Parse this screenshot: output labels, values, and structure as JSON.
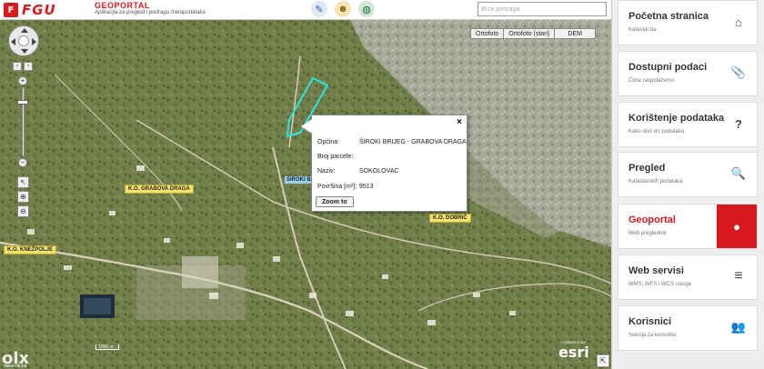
{
  "header": {
    "logo_mark": "F",
    "logo_text": "FGU",
    "brand_title": "GEOPORTAL",
    "brand_subtitle": "Aplikacija za pregled i pretragu metapodataka",
    "search_placeholder": "Brza pretraga",
    "icons": [
      "tools-icon",
      "user-badge-icon",
      "globe-icon"
    ]
  },
  "map": {
    "basemaps": [
      "Ortofoto",
      "Ortofoto (stari)",
      "DEM"
    ],
    "labels": [
      "K.O. GRABOVA DRAGA",
      "K.O. KNEŽPOLJE",
      "K.O. DOBRIČ"
    ],
    "tag": "ŠIROKI BR",
    "scale_label": "1000 m",
    "esri_text": "esri",
    "esri_powered": "POWERED BY",
    "watermark": "olx",
    "watermark_url": "www.olx.ba",
    "popup": {
      "close_label": "×",
      "rows": [
        {
          "key": "Općina:",
          "value": "ŠIROKI BRIJEG - GRABOVA DRAGA"
        },
        {
          "key": "Broj parcele:",
          "value": ""
        },
        {
          "key": "Naziv:",
          "value": "SOKOLOVAC"
        },
        {
          "key": "Površina [m²]:",
          "value": "9513"
        }
      ],
      "zoom_label": "Zoom to"
    }
  },
  "sidebar": {
    "items": [
      {
        "title": "Početna stranica",
        "subtitle": "Katastar.ba",
        "icon": "home-icon",
        "glyph": "⌂",
        "active": false
      },
      {
        "title": "Dostupni podaci",
        "subtitle": "Čime raspolažemo",
        "icon": "paperclip-icon",
        "glyph": "📎",
        "active": false
      },
      {
        "title": "Korištenje podataka",
        "subtitle": "Kako doći do podataka",
        "icon": "question-icon",
        "glyph": "?",
        "active": false
      },
      {
        "title": "Pregled",
        "subtitle": "Katastarskih podataka",
        "icon": "search-icon",
        "glyph": "🔍",
        "active": false
      },
      {
        "title": "Geoportal",
        "subtitle": "Web preglednik",
        "icon": "map-marker-icon",
        "glyph": "●",
        "active": true
      },
      {
        "title": "Web servisi",
        "subtitle": "WMS, WFS i WCS usluge",
        "icon": "database-icon",
        "glyph": "≡",
        "active": false
      },
      {
        "title": "Korisnici",
        "subtitle": "Sekcija za korisnike",
        "icon": "users-icon",
        "glyph": "👥",
        "active": false
      }
    ]
  },
  "colors": {
    "brand_red": "#d71920",
    "parcel_outline": "#27e6e0",
    "label_yellow": "#f3e36d"
  }
}
